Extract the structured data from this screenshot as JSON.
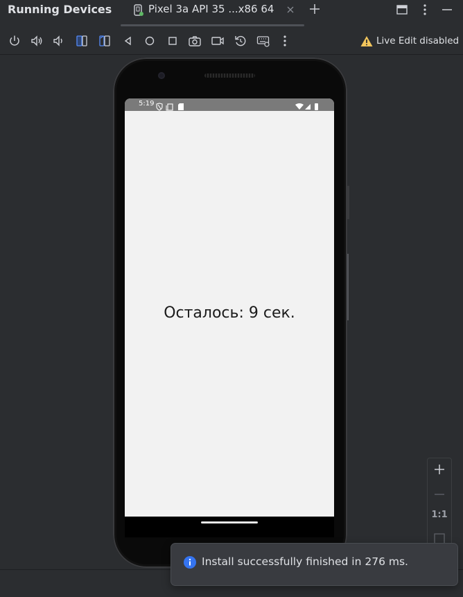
{
  "window": {
    "title": "Running Devices",
    "tab": {
      "label": "Pixel 3a API 35 ...x86 64"
    }
  },
  "toolbar": {
    "icons": [
      "power-icon",
      "volume-up-icon",
      "volume-down-icon",
      "rotate-left-icon",
      "rotate-right-icon",
      "back-icon",
      "home-icon",
      "overview-icon",
      "screenshot-icon",
      "screen-record-icon",
      "reset-icon",
      "keyboard-icon",
      "more-icon"
    ],
    "live_edit_label": "Live Edit disabled"
  },
  "device": {
    "status_time": "5:19",
    "countdown_text": "Осталось: 9 сек."
  },
  "zoom": {
    "one_to_one": "1:1"
  },
  "notification": {
    "text": "Install successfully finished in 276 ms."
  },
  "colors": {
    "accent": "#3574f0",
    "warning": "#f2c55c",
    "background": "#2b2d30"
  }
}
